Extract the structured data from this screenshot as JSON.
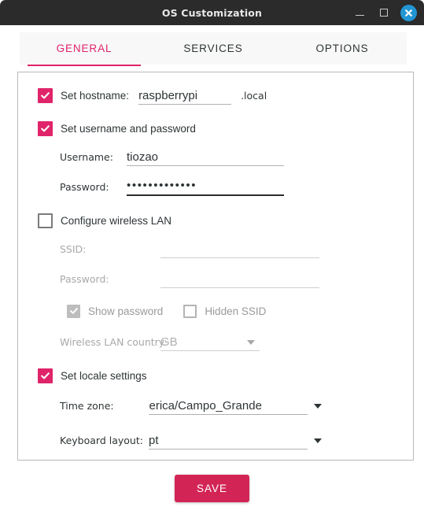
{
  "window": {
    "title": "OS Customization",
    "controls": {
      "minimize": "minimize",
      "maximize": "maximize",
      "close": "close"
    }
  },
  "tabs": [
    {
      "label": "GENERAL",
      "active": true
    },
    {
      "label": "SERVICES",
      "active": false
    },
    {
      "label": "OPTIONS",
      "active": false
    }
  ],
  "form": {
    "hostname": {
      "checkbox_label": "Set hostname:",
      "checked": true,
      "value": "raspberrypi",
      "suffix": ".local"
    },
    "user": {
      "checkbox_label": "Set username and password",
      "checked": true,
      "username_label": "Username:",
      "username_value": "tiozao",
      "password_label": "Password:",
      "password_value": "•••••••••••••"
    },
    "wireless": {
      "checkbox_label": "Configure wireless LAN",
      "checked": false,
      "disabled": true,
      "ssid_label": "SSID:",
      "ssid_value": "",
      "password_label": "Password:",
      "password_value": "",
      "show_password_label": "Show password",
      "show_password_checked": true,
      "hidden_ssid_label": "Hidden SSID",
      "hidden_ssid_checked": false,
      "country_label": "Wireless LAN country:",
      "country_value": "GB"
    },
    "locale": {
      "checkbox_label": "Set locale settings",
      "checked": true,
      "timezone_label": "Time zone:",
      "timezone_value": "America/Campo_Grande",
      "keyboard_label": "Keyboard layout:",
      "keyboard_value": "pt"
    }
  },
  "footer": {
    "save_label": "SAVE"
  },
  "colors": {
    "accent": "#e0246a",
    "save_button": "#d22556",
    "titlebar": "#2b2b2b",
    "close_button": "#2196d3"
  }
}
